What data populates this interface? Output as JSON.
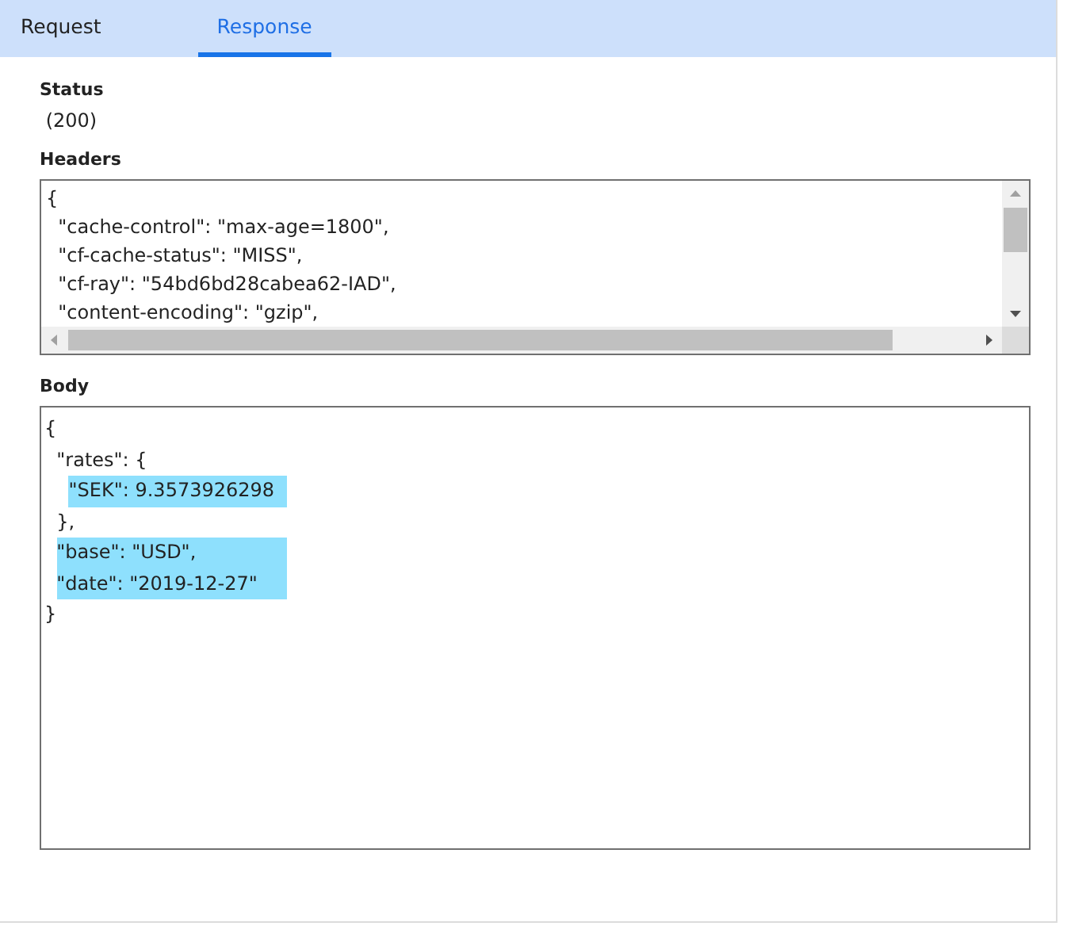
{
  "tabs": [
    {
      "label": "Request",
      "selected": false
    },
    {
      "label": "Response",
      "selected": true
    }
  ],
  "status": {
    "label": "Status",
    "value": " (200)"
  },
  "headers": {
    "label": "Headers",
    "lines": [
      "{",
      "  \"cache-control\": \"max-age=1800\",",
      "  \"cf-cache-status\": \"MISS\",",
      "  \"cf-ray\": \"54bd6bd28cabea62-IAD\",",
      "  \"content-encoding\": \"gzip\","
    ]
  },
  "body": {
    "label": "Body",
    "lines": [
      {
        "text": "{",
        "highlighted": false
      },
      {
        "text": "  \"rates\": {",
        "highlighted": false
      },
      {
        "text": "    \"SEK\": 9.3573926298",
        "highlighted": true
      },
      {
        "text": "  },",
        "highlighted": false
      },
      {
        "text": "  \"base\": \"USD\",",
        "highlighted": true
      },
      {
        "text": "  \"date\": \"2019-12-27\"",
        "highlighted": true
      },
      {
        "text": "}",
        "highlighted": false
      }
    ]
  }
}
